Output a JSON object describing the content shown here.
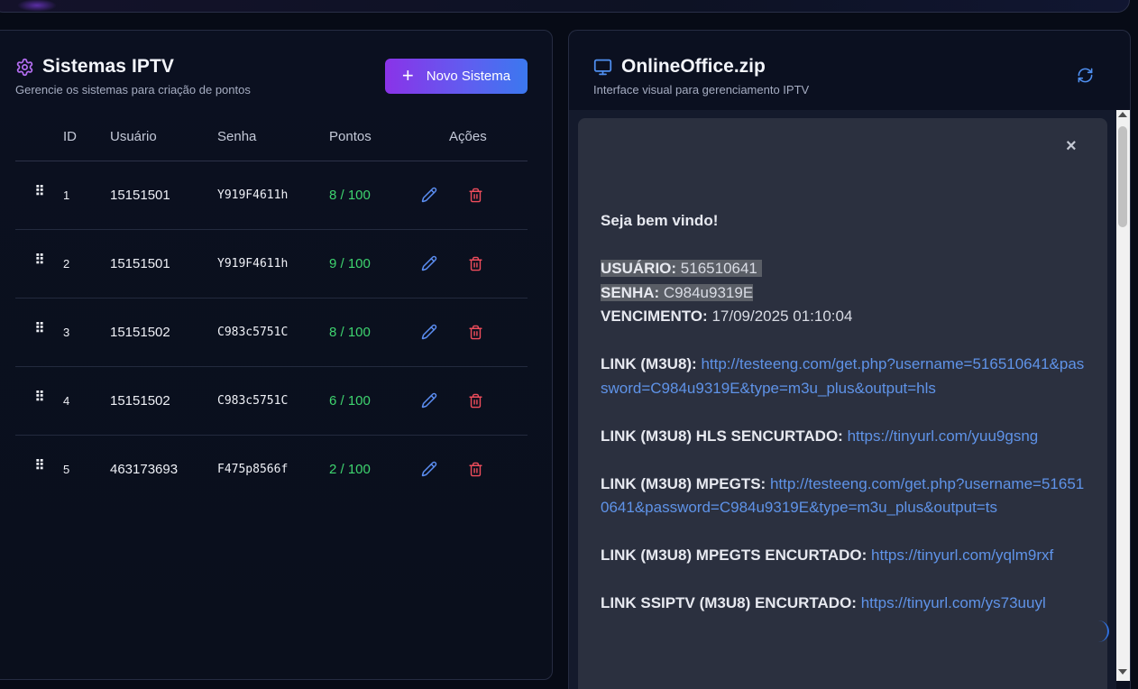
{
  "colors": {
    "accent_from": "#8a33e8",
    "accent_to": "#3b78ef",
    "points": "#3ed46f",
    "edit": "#5b8ef2",
    "delete": "#ef4d5c",
    "link": "#5f93e8"
  },
  "left_panel": {
    "title": "Sistemas IPTV",
    "subtitle": "Gerencie os sistemas para criação de pontos",
    "title_icon": "gear-icon",
    "new_button": "Novo Sistema",
    "columns": [
      "ID",
      "Usuário",
      "Senha",
      "Pontos",
      "Ações"
    ],
    "rows": [
      {
        "id": "1",
        "user": "15151501",
        "pass": "Y919F4611h",
        "points": "8 / 100"
      },
      {
        "id": "2",
        "user": "15151501",
        "pass": "Y919F4611h",
        "points": "9 / 100"
      },
      {
        "id": "3",
        "user": "15151502",
        "pass": "C983c5751C",
        "points": "8 / 100"
      },
      {
        "id": "4",
        "user": "15151502",
        "pass": "C983c5751C",
        "points": "6 / 100"
      },
      {
        "id": "5",
        "user": "463173693",
        "pass": "F475p8566f",
        "points": "2 / 100"
      }
    ]
  },
  "right_panel": {
    "title": "OnlineOffice.zip",
    "subtitle": "Interface visual para gerenciamento IPTV",
    "title_icon": "monitor-icon",
    "close": "×",
    "message": {
      "greeting": "Seja bem vindo!",
      "user_label": "USUÁRIO:",
      "user_value": "516510641",
      "pass_label": "SENHA:",
      "pass_value": "C984u9319E",
      "exp_label": "VENCIMENTO:",
      "exp_value": "17/09/2025 01:10:04",
      "link1_label": "LINK (M3U8):",
      "link1_value": "http://testeeng.com/get.php?username=516510641&password=C984u9319E&type=m3u_plus&output=hls",
      "link2_label": "LINK (M3U8) HLS SENCURTADO:",
      "link2_value": "https://tinyurl.com/yuu9gsng",
      "link3_label": "LINK (M3U8) MPEGTS:",
      "link3_value": "http://testeeng.com/get.php?username=516510641&password=C984u9319E&type=m3u_plus&output=ts",
      "link4_label": "LINK (M3U8) MPEGTS ENCURTADO:",
      "link4_value": "https://tinyurl.com/yqlm9rxf",
      "link5_label": "LINK SSIPTV (M3U8) ENCURTADO:",
      "link5_value": "https://tinyurl.com/ys73uuyl"
    }
  }
}
